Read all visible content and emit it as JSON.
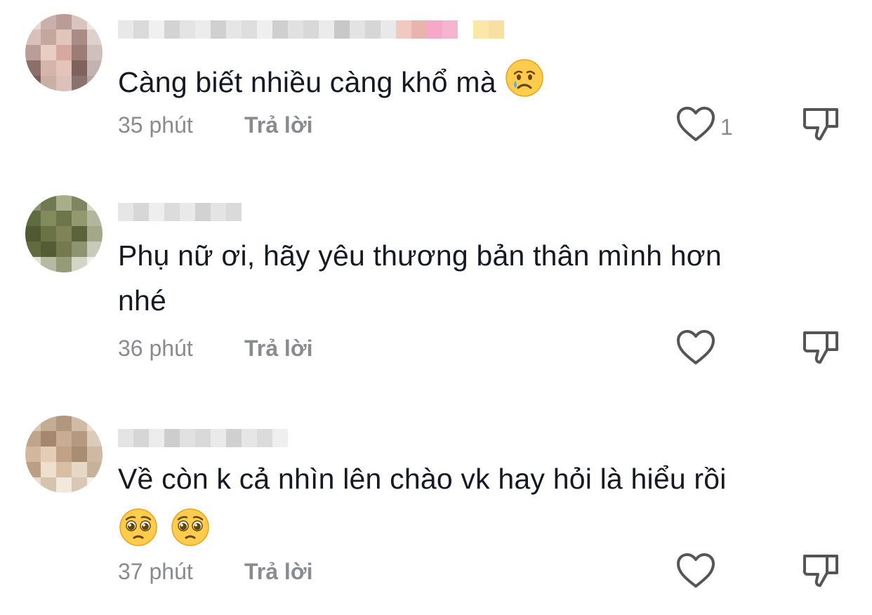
{
  "comments": [
    {
      "text": "Càng biết nhiều càng khổ mà",
      "time": "35 phút",
      "reply_label": "Trả lời",
      "like_count": "1",
      "emoji": [
        "crying-face"
      ]
    },
    {
      "text_line1": "Phụ nữ ơi, hãy yêu thương bản thân mình hơn",
      "text_line2": "nhé",
      "time": "36 phút",
      "reply_label": "Trả lời"
    },
    {
      "text": "Về còn k cả nhìn lên chào vk hay hỏi là hiểu rồi",
      "time": "37 phút",
      "reply_label": "Trả lời",
      "emoji": [
        "pleading-face",
        "pleading-face"
      ]
    }
  ],
  "colors": {
    "text": "#161823",
    "muted": "#8a8b91",
    "icon": "#444444"
  },
  "icons": {
    "like": "heart-outline-icon",
    "dislike": "thumbs-down-icon"
  }
}
